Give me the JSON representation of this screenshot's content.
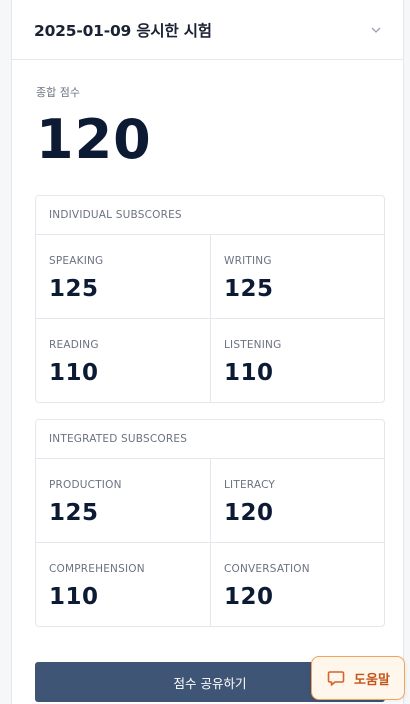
{
  "header": {
    "title": "2025-01-09 응시한 시험",
    "icon": "chevron-down-icon"
  },
  "overall": {
    "label": "종합 점수",
    "score": "120"
  },
  "individual": {
    "title": "INDIVIDUAL SUBSCORES",
    "items": [
      {
        "label": "SPEAKING",
        "value": "125"
      },
      {
        "label": "WRITING",
        "value": "125"
      },
      {
        "label": "READING",
        "value": "110"
      },
      {
        "label": "LISTENING",
        "value": "110"
      }
    ]
  },
  "integrated": {
    "title": "INTEGRATED SUBSCORES",
    "items": [
      {
        "label": "PRODUCTION",
        "value": "125"
      },
      {
        "label": "LITERACY",
        "value": "120"
      },
      {
        "label": "COMPREHENSION",
        "value": "110"
      },
      {
        "label": "CONVERSATION",
        "value": "120"
      }
    ]
  },
  "actions": {
    "share_label": "점수 공유하기"
  },
  "help": {
    "label": "도움말",
    "icon": "chat-bubble-icon"
  },
  "colors": {
    "button": "#3f5575",
    "help_accent": "#f0a35a",
    "score_text": "#0c1a33"
  }
}
